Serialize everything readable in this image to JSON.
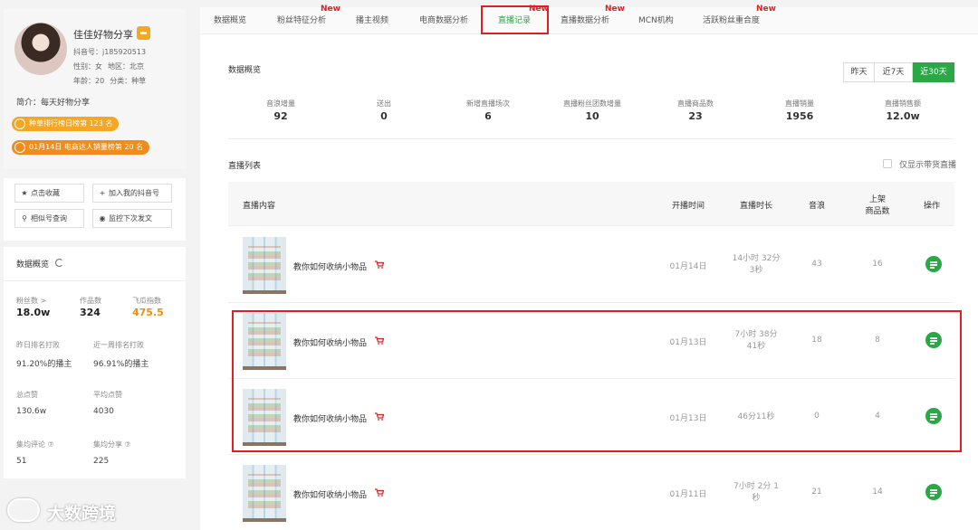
{
  "profile": {
    "name": "佳佳好物分享",
    "douyin_id": "抖音号：j185920513",
    "gender": "性别：女",
    "region": "地区：北京",
    "age": "年龄：20",
    "category": "分类：种草",
    "intro": "简介：每天好物分享",
    "rank1": "种草排行榜日榜第 123 名",
    "rank2": "01月14日 电商达人销量榜第 20 名"
  },
  "actions": {
    "favorite": "点击收藏",
    "add": "加入我的抖音号",
    "similar": "相似号查询",
    "monitor": "监控下次发文"
  },
  "stats": {
    "title": "数据概览",
    "fans_label": "粉丝数 >",
    "fans_value": "18.0w",
    "works_label": "作品数",
    "works_value": "324",
    "index_label": "飞瓜指数",
    "index_value": "475.5",
    "yesterday_label": "昨日排名打败",
    "yesterday_value": "91.20%的播主",
    "week_label": "近一周排名打败",
    "week_value": "96.91%的播主",
    "likes_label": "总点赞",
    "likes_value": "130.6w",
    "avg_label": "平均点赞",
    "avg_value": "4030",
    "comments_label": "集均评论 ⑦",
    "comments_value": "51",
    "shares_label": "集均分享 ⑦",
    "shares_value": "225"
  },
  "watermark": "大数跨境",
  "tabs": [
    {
      "label": "数据概览",
      "new": ""
    },
    {
      "label": "粉丝特征分析",
      "new": "New"
    },
    {
      "label": "播主视频",
      "new": ""
    },
    {
      "label": "电商数据分析",
      "new": ""
    },
    {
      "label": "直播记录",
      "new": "New"
    },
    {
      "label": "直播数据分析",
      "new": "New"
    },
    {
      "label": "MCN机构",
      "new": ""
    },
    {
      "label": "活跃粉丝重合度",
      "new": "New"
    }
  ],
  "overview": {
    "title": "数据概览",
    "ranges": [
      "昨天",
      "近7天",
      "近30天"
    ],
    "metrics": [
      {
        "label": "音浪增量",
        "value": "92"
      },
      {
        "label": "送出",
        "value": "0"
      },
      {
        "label": "新增直播场次",
        "value": "6"
      },
      {
        "label": "直播粉丝团数增量",
        "value": "10"
      },
      {
        "label": "直播商品数",
        "value": "23"
      },
      {
        "label": "直播销量",
        "value": "1956"
      },
      {
        "label": "直播销售额",
        "value": "12.0w"
      }
    ]
  },
  "live_list": {
    "title": "直播列表",
    "filter_label": "仅显示带货直播",
    "columns": [
      "直播内容",
      "开播时间",
      "直播时长",
      "音浪",
      "上架",
      "商品数",
      "操作"
    ],
    "rows": [
      {
        "title": "教你如何收纳小物品",
        "date": "01月14日",
        "dur1": "14小时 32分",
        "dur2": "3秒",
        "sound": "43",
        "goods": "16"
      },
      {
        "title": "教你如何收纳小物品",
        "date": "01月13日",
        "dur1": "7小时 38分",
        "dur2": "41秒",
        "sound": "18",
        "goods": "8"
      },
      {
        "title": "教你如何收纳小物品",
        "date": "01月13日",
        "dur1": "46分11秒",
        "dur2": "",
        "sound": "0",
        "goods": "4"
      },
      {
        "title": "教你如何收纳小物品",
        "date": "01月11日",
        "dur1": "7小时 2分 1",
        "dur2": "秒",
        "sound": "21",
        "goods": "14"
      }
    ]
  },
  "colors": {
    "accent": "#2aa845",
    "orange": "#f5a623",
    "highlight": "#e02020"
  }
}
